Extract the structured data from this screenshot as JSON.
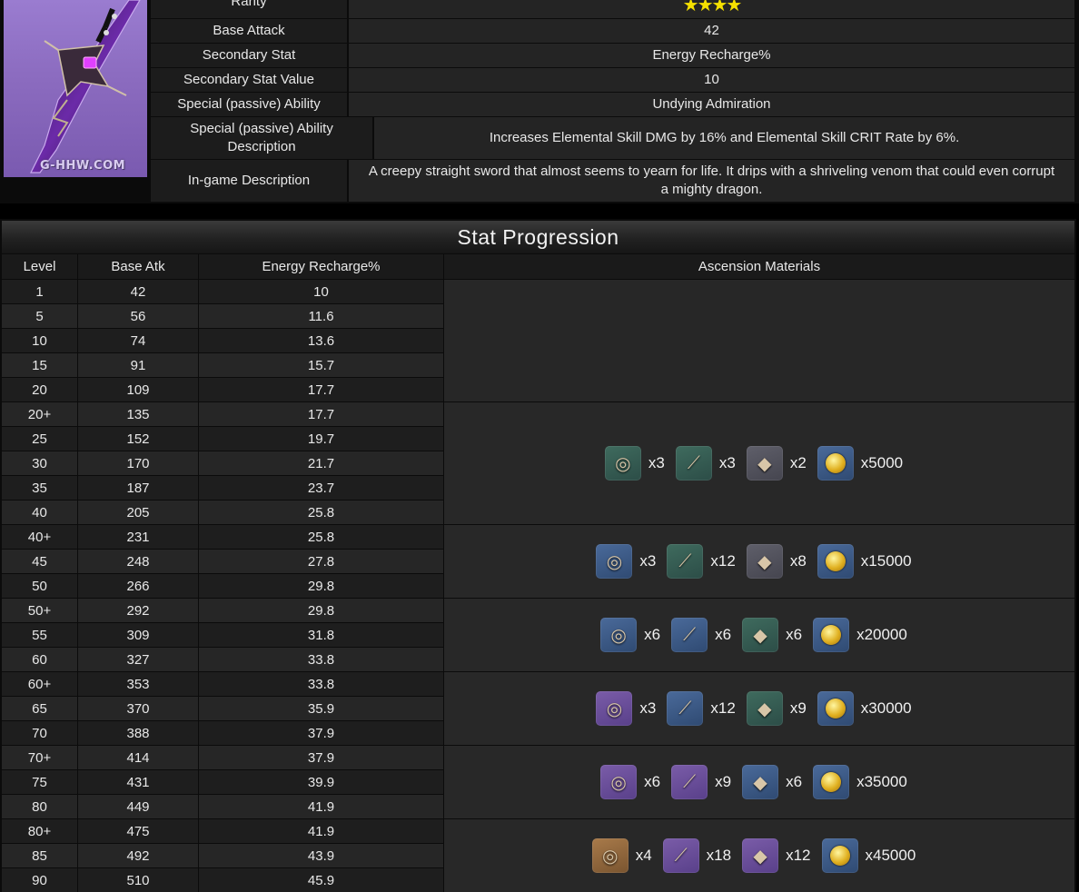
{
  "weapon": {
    "watermark": "G-HHW.COM",
    "rows": [
      {
        "label": "Rarity",
        "value": "★★★★"
      },
      {
        "label": "Base Attack",
        "value": "42"
      },
      {
        "label": "Secondary Stat",
        "value": "Energy Recharge%"
      },
      {
        "label": "Secondary Stat Value",
        "value": "10"
      },
      {
        "label": "Special (passive) Ability",
        "value": "Undying Admiration"
      },
      {
        "label": "Special (passive) Ability Description",
        "value": "Increases Elemental Skill DMG by 16% and Elemental Skill CRIT Rate by 6%."
      },
      {
        "label": "In-game Description",
        "value": "A creepy straight sword that almost seems to yearn for life. It drips with a shriveling venom that could even corrupt a mighty dragon."
      }
    ]
  },
  "progression": {
    "title": "Stat Progression",
    "headers": [
      "Level",
      "Base Atk",
      "Energy Recharge%",
      "Ascension Materials"
    ],
    "rows": [
      [
        "1",
        "42",
        "10"
      ],
      [
        "5",
        "56",
        "11.6"
      ],
      [
        "10",
        "74",
        "13.6"
      ],
      [
        "15",
        "91",
        "15.7"
      ],
      [
        "20",
        "109",
        "17.7"
      ],
      [
        "20+",
        "135",
        "17.7"
      ],
      [
        "25",
        "152",
        "19.7"
      ],
      [
        "30",
        "170",
        "21.7"
      ],
      [
        "35",
        "187",
        "23.7"
      ],
      [
        "40",
        "205",
        "25.8"
      ],
      [
        "40+",
        "231",
        "25.8"
      ],
      [
        "45",
        "248",
        "27.8"
      ],
      [
        "50",
        "266",
        "29.8"
      ],
      [
        "50+",
        "292",
        "29.8"
      ],
      [
        "55",
        "309",
        "31.8"
      ],
      [
        "60",
        "327",
        "33.8"
      ],
      [
        "60+",
        "353",
        "33.8"
      ],
      [
        "65",
        "370",
        "35.9"
      ],
      [
        "70",
        "388",
        "37.9"
      ],
      [
        "70+",
        "414",
        "37.9"
      ],
      [
        "75",
        "431",
        "39.9"
      ],
      [
        "80",
        "449",
        "41.9"
      ],
      [
        "80+",
        "475",
        "41.9"
      ],
      [
        "85",
        "492",
        "43.9"
      ],
      [
        "90",
        "510",
        "45.9"
      ]
    ],
    "materials": [
      [
        {
          "icon": "ring-icon",
          "bg": "green",
          "qty": "x3"
        },
        {
          "icon": "horn-icon",
          "bg": "green",
          "qty": "x3"
        },
        {
          "icon": "insignia-icon",
          "bg": "gray",
          "qty": "x2"
        },
        {
          "icon": "mora-coin-icon",
          "bg": "blue",
          "qty": "x5000"
        }
      ],
      [
        {
          "icon": "ring-icon",
          "bg": "blue",
          "qty": "x3"
        },
        {
          "icon": "horn-icon",
          "bg": "green",
          "qty": "x12"
        },
        {
          "icon": "insignia-icon",
          "bg": "gray",
          "qty": "x8"
        },
        {
          "icon": "mora-coin-icon",
          "bg": "blue",
          "qty": "x15000"
        }
      ],
      [
        {
          "icon": "ring-icon",
          "bg": "blue",
          "qty": "x6"
        },
        {
          "icon": "horn-icon",
          "bg": "blue",
          "qty": "x6"
        },
        {
          "icon": "insignia-icon",
          "bg": "green",
          "qty": "x6"
        },
        {
          "icon": "mora-coin-icon",
          "bg": "blue",
          "qty": "x20000"
        }
      ],
      [
        {
          "icon": "ring-icon",
          "bg": "purple",
          "qty": "x3"
        },
        {
          "icon": "horn-icon",
          "bg": "blue",
          "qty": "x12"
        },
        {
          "icon": "insignia-icon",
          "bg": "green",
          "qty": "x9"
        },
        {
          "icon": "mora-coin-icon",
          "bg": "blue",
          "qty": "x30000"
        }
      ],
      [
        {
          "icon": "ring-icon",
          "bg": "purple",
          "qty": "x6"
        },
        {
          "icon": "horn-icon",
          "bg": "purple",
          "qty": "x9"
        },
        {
          "icon": "insignia-icon",
          "bg": "blue",
          "qty": "x6"
        },
        {
          "icon": "mora-coin-icon",
          "bg": "blue",
          "qty": "x35000"
        }
      ],
      [
        {
          "icon": "ring-icon",
          "bg": "gold",
          "qty": "x4"
        },
        {
          "icon": "horn-icon",
          "bg": "purple",
          "qty": "x18"
        },
        {
          "icon": "insignia-icon",
          "bg": "purple",
          "qty": "x12"
        },
        {
          "icon": "mora-coin-icon",
          "bg": "blue",
          "qty": "x45000"
        }
      ]
    ]
  }
}
